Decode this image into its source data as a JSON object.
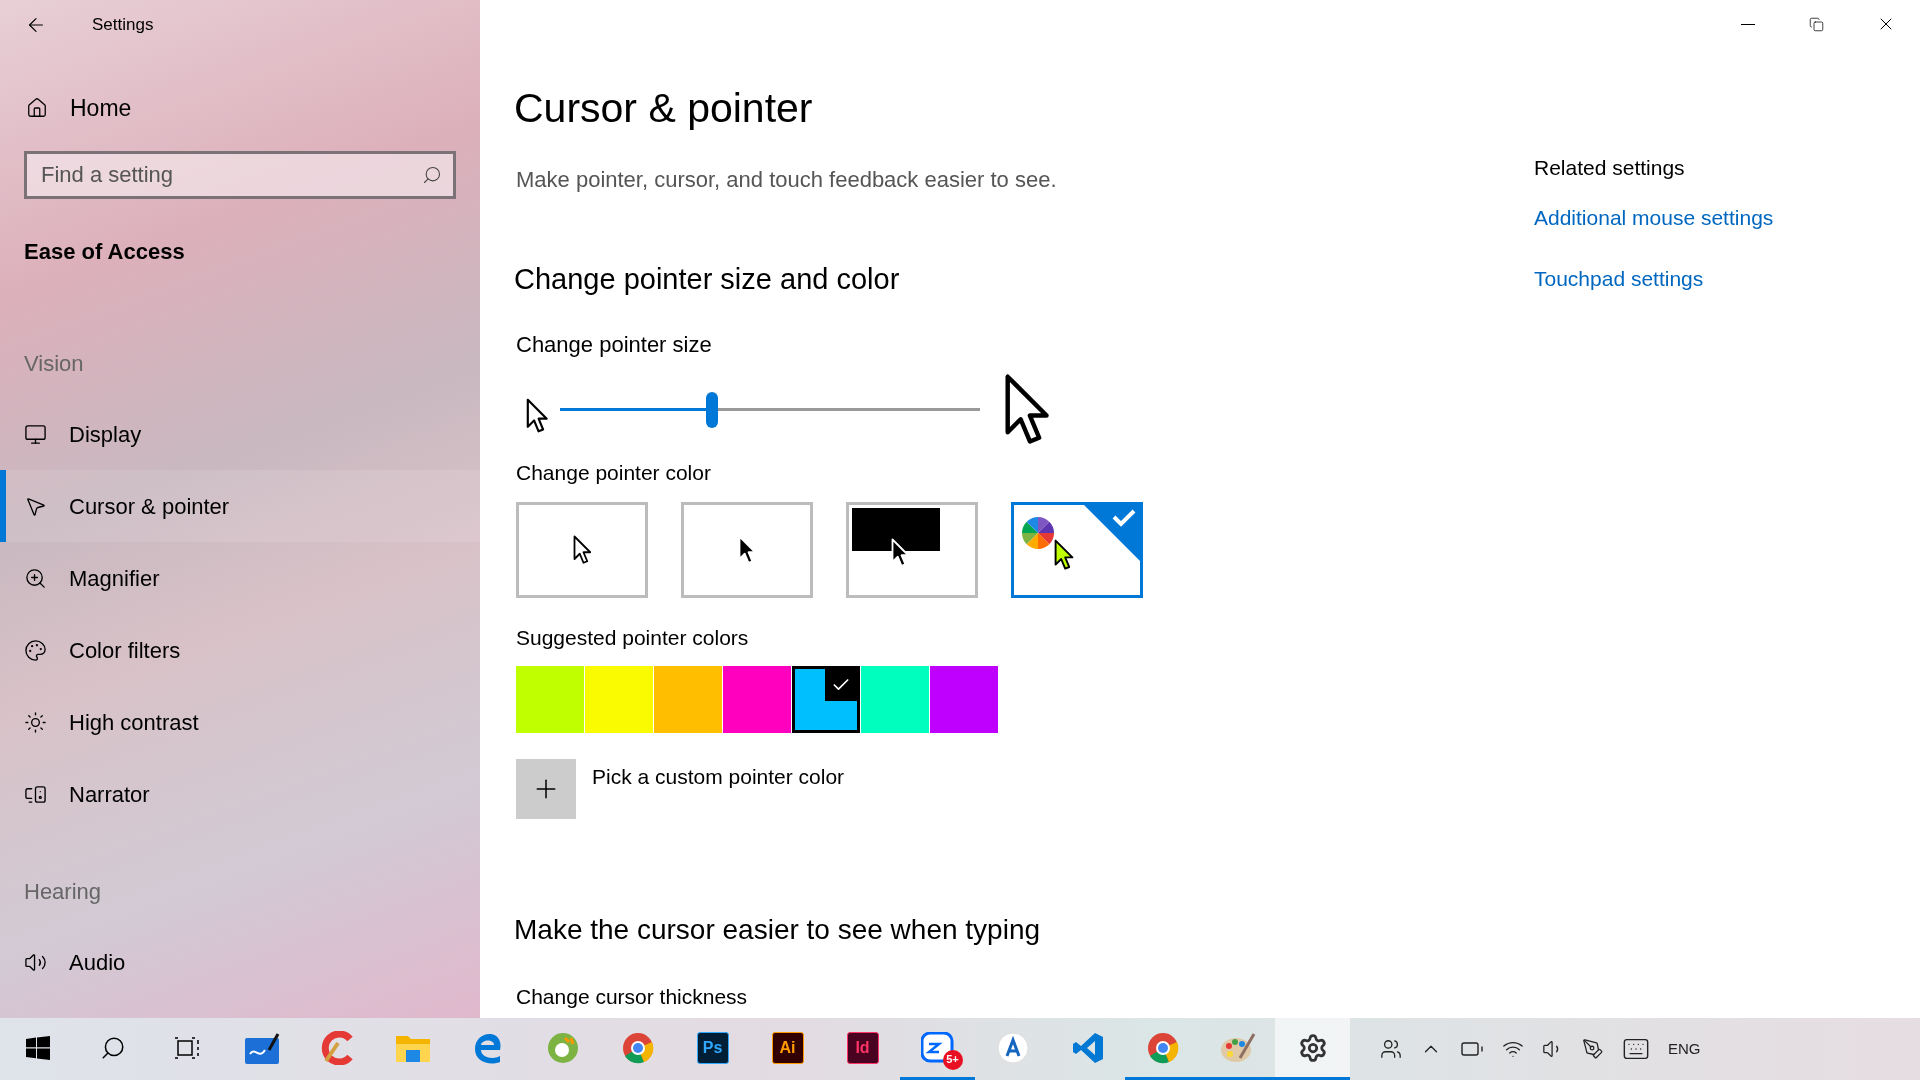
{
  "window": {
    "title": "Settings"
  },
  "sidebar": {
    "home": "Home",
    "search": {
      "placeholder": "Find a setting"
    },
    "category": "Ease of Access",
    "groups": [
      {
        "heading": "Vision",
        "items": [
          {
            "label": "Display",
            "kind": "display",
            "selected": false
          },
          {
            "label": "Cursor & pointer",
            "kind": "cursor",
            "selected": true
          },
          {
            "label": "Magnifier",
            "kind": "magnifier",
            "selected": false
          },
          {
            "label": "Color filters",
            "kind": "palette",
            "selected": false
          },
          {
            "label": "High contrast",
            "kind": "sun",
            "selected": false
          },
          {
            "label": "Narrator",
            "kind": "narrator",
            "selected": false
          }
        ]
      },
      {
        "heading": "Hearing",
        "items": [
          {
            "label": "Audio",
            "kind": "audio",
            "selected": false
          }
        ]
      }
    ]
  },
  "page": {
    "title": "Cursor & pointer",
    "description": "Make pointer, cursor, and touch feedback easier to see.",
    "size_heading": "Change pointer size and color",
    "size_label": "Change pointer size",
    "size_slider": {
      "level": 0.36
    },
    "color_label": "Change pointer color",
    "color_options": [
      {
        "kind": "white",
        "selected": false
      },
      {
        "kind": "black",
        "selected": false
      },
      {
        "kind": "inverted",
        "selected": false
      },
      {
        "kind": "custom",
        "selected": true
      }
    ],
    "suggested_label": "Suggested pointer colors",
    "swatches": [
      {
        "color": "#bfff00",
        "selected": false
      },
      {
        "color": "#fafa00",
        "selected": false
      },
      {
        "color": "#ffbf00",
        "selected": false
      },
      {
        "color": "#ff00bf",
        "selected": false
      },
      {
        "color": "#00bfff",
        "selected": true
      },
      {
        "color": "#00ffbf",
        "selected": false
      },
      {
        "color": "#bf00ff",
        "selected": false
      }
    ],
    "custom_label": "Pick a custom pointer color",
    "typing_heading": "Make the cursor easier to see when typing",
    "thickness_label": "Change cursor thickness"
  },
  "related": {
    "heading": "Related settings",
    "links": [
      "Additional mouse settings",
      "Touchpad settings"
    ]
  },
  "taskbar": {
    "apps": [
      {
        "kind": "start",
        "active": false
      },
      {
        "kind": "search",
        "active": false
      },
      {
        "kind": "taskview",
        "active": false
      },
      {
        "kind": "whiteboard",
        "active": false
      },
      {
        "kind": "cleaner",
        "active": false
      },
      {
        "kind": "folder",
        "active": false
      },
      {
        "kind": "edge",
        "active": false
      },
      {
        "kind": "leaf",
        "active": false
      },
      {
        "kind": "chrome",
        "active": false
      },
      {
        "kind": "photo-editor",
        "label": "Ps",
        "active": false
      },
      {
        "kind": "vector-editor",
        "label": "Ai",
        "active": false
      },
      {
        "kind": "layout-editor",
        "label": "Id",
        "active": false
      },
      {
        "kind": "chat",
        "badge": "5+",
        "active": true
      },
      {
        "kind": "circle-app",
        "active": false
      },
      {
        "kind": "code",
        "active": false
      },
      {
        "kind": "chrome",
        "active": true
      },
      {
        "kind": "paint",
        "active": true
      },
      {
        "kind": "gear",
        "active": true
      }
    ],
    "language": "ENG"
  }
}
